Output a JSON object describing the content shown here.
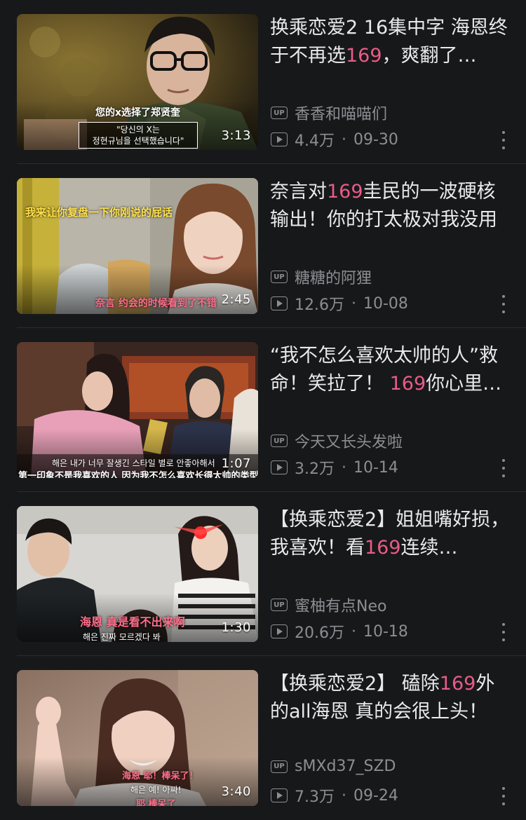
{
  "feed": {
    "cards": [
      {
        "title_parts": [
          "换乘恋爱2 16集中字 海恩终于不再选",
          "169",
          "，爽翻了…"
        ],
        "uploader": "香香和喵喵们",
        "views": "4.4万",
        "date": "09-30",
        "duration": "3:13",
        "thumb_captions": [
          "您的x选择了郑贤奎",
          "\"당신의 X는\n정현규님을 선택했습니다\""
        ]
      },
      {
        "title_parts": [
          "奈言对",
          "169",
          "圭民的一波硬核输出！你的打太极对我没用"
        ],
        "uploader": "糖糖的阿狸",
        "views": "12.6万",
        "date": "10-08",
        "duration": "2:45",
        "thumb_captions": [
          "我来让你复盘一下你刚说的屁话",
          "奈言 约会的时候看到了不错"
        ]
      },
      {
        "title_parts": [
          "“我不怎么喜欢太帅的人”救命！笑拉了！ ",
          "169",
          "你心里…"
        ],
        "uploader": "今天又长头发啦",
        "views": "3.2万",
        "date": "10-14",
        "duration": "1:07",
        "thumb_captions": [
          "해은 내가 너무 잘생긴 스타일 별로 안좋아해서",
          "第一印象不是我喜欢的人 因为我不怎么喜欢长得太帅的类型"
        ]
      },
      {
        "title_parts": [
          "【换乘恋爱2】姐姐嘴好损，我喜欢！看",
          "169",
          "连续…"
        ],
        "uploader": "蜜柚有点Neo",
        "views": "20.6万",
        "date": "10-18",
        "duration": "1:30",
        "thumb_captions": [
          "海恩 真是看不出来啊",
          "해은 진짜 모르겠다 봐"
        ]
      },
      {
        "title_parts": [
          "【换乘恋爱2】 磕除",
          "169",
          "外的all海恩 真的会很上头！"
        ],
        "uploader": "sMXd37_SZD",
        "views": "7.3万",
        "date": "09-24",
        "duration": "3:40",
        "thumb_captions": [
          "海恩 耶！棒呆了！",
          "해은 예! 아싸!",
          "耶 棒呆了"
        ]
      }
    ]
  },
  "icons": {
    "up_badge_text": "UP",
    "views_icon": "play-count-icon",
    "more_icon": "more-vertical-icon",
    "dot_separator": "·"
  },
  "colors": {
    "background": "#17181a",
    "title_text": "#e9e9ec",
    "meta_text": "#8d8e93",
    "highlight": "#e85c86"
  }
}
